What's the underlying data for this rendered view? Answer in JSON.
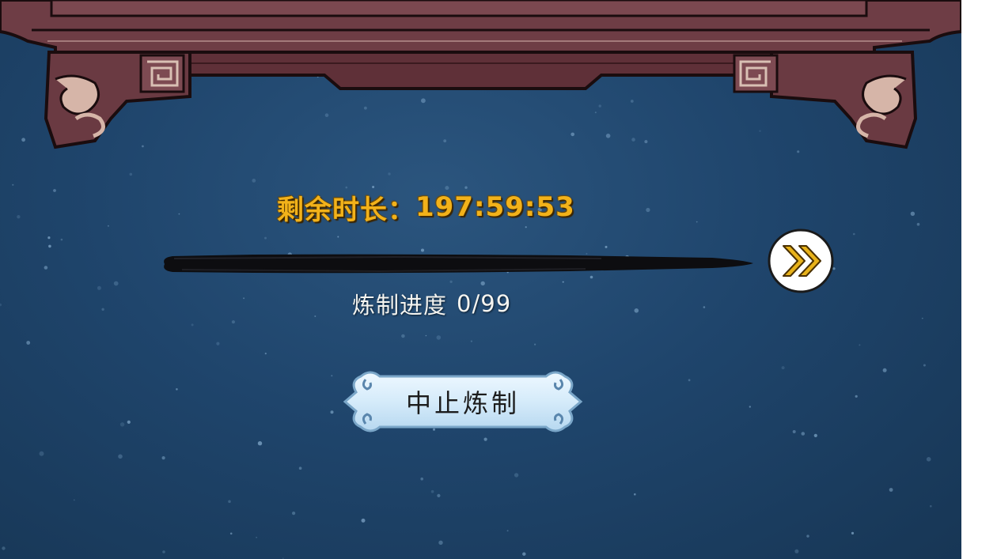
{
  "timer": {
    "label": "剩余时长：",
    "value": "197:59:53"
  },
  "progress": {
    "label": "炼制进度",
    "current": "0",
    "separator": "/",
    "total": "99",
    "fraction": 0
  },
  "buttons": {
    "stop_label": "中止炼制",
    "skip_icon": "double-chevron-right-icon"
  },
  "colors": {
    "background": "#1f456c",
    "timer_text": "#f2b21a",
    "frame_wood": "#6e3d45",
    "button_face": "#dceefa",
    "skip_arrows": "#e8b21a"
  }
}
